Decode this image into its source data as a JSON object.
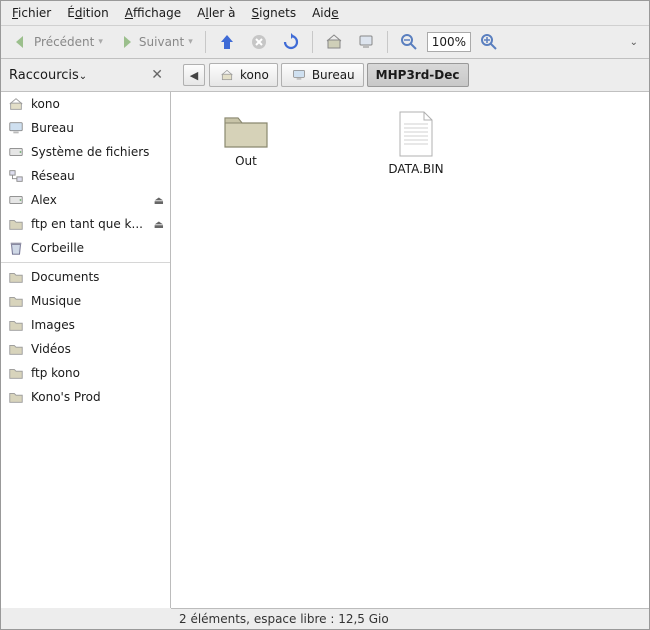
{
  "menu": {
    "items": [
      {
        "html": "<u>F</u>ichier"
      },
      {
        "html": "É<u>d</u>ition"
      },
      {
        "html": "<u>A</u>ffichage"
      },
      {
        "html": "A<u>l</u>ler à"
      },
      {
        "html": "<u>S</u>ignets"
      },
      {
        "html": "Aid<u>e</u>"
      }
    ]
  },
  "toolbar": {
    "back": "Précédent",
    "forward": "Suivant",
    "zoom": "100%"
  },
  "pathbar": {
    "sidebar_title": "Raccourcis",
    "crumbs": [
      {
        "label": "kono",
        "icon": "home"
      },
      {
        "label": "Bureau",
        "icon": "desktop"
      },
      {
        "label": "MHP3rd-Dec",
        "active": true
      }
    ]
  },
  "sidebar": {
    "places": [
      {
        "label": "kono",
        "icon": "home"
      },
      {
        "label": "Bureau",
        "icon": "desktop"
      },
      {
        "label": "Système de fichiers",
        "icon": "disk"
      },
      {
        "label": "Réseau",
        "icon": "network"
      },
      {
        "label": "Alex",
        "icon": "disk",
        "eject": true
      },
      {
        "label": "ftp en tant que k...",
        "icon": "folder",
        "eject": true
      },
      {
        "label": "Corbeille",
        "icon": "trash"
      }
    ],
    "bookmarks": [
      {
        "label": "Documents",
        "icon": "folder"
      },
      {
        "label": "Musique",
        "icon": "folder"
      },
      {
        "label": "Images",
        "icon": "folder"
      },
      {
        "label": "Vidéos",
        "icon": "folder"
      },
      {
        "label": "ftp kono",
        "icon": "folder"
      },
      {
        "label": "Kono's Prod",
        "icon": "folder"
      }
    ]
  },
  "content": {
    "items": [
      {
        "label": "Out",
        "type": "folder"
      },
      {
        "label": "DATA.BIN",
        "type": "file"
      }
    ]
  },
  "statusbar": {
    "text": "2 éléments, espace libre : 12,5 Gio"
  }
}
